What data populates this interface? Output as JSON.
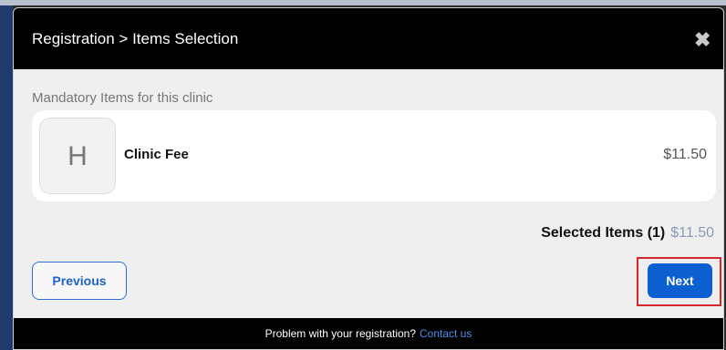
{
  "header": {
    "title": "Registration > Items Selection",
    "close_glyph": "✖"
  },
  "section": {
    "label": "Mandatory Items for this clinic"
  },
  "items": [
    {
      "avatar_letter": "H",
      "name": "Clinic Fee",
      "price": "$11.50"
    }
  ],
  "summary": {
    "label": "Selected Items (1)",
    "amount": "$11.50"
  },
  "buttons": {
    "previous": "Previous",
    "next": "Next"
  },
  "footer": {
    "text": "Problem with your registration?",
    "link": "Contact us"
  },
  "colors": {
    "accent": "#0c5fd1",
    "highlight_outline": "#d6262b",
    "header_bg": "#000000"
  }
}
